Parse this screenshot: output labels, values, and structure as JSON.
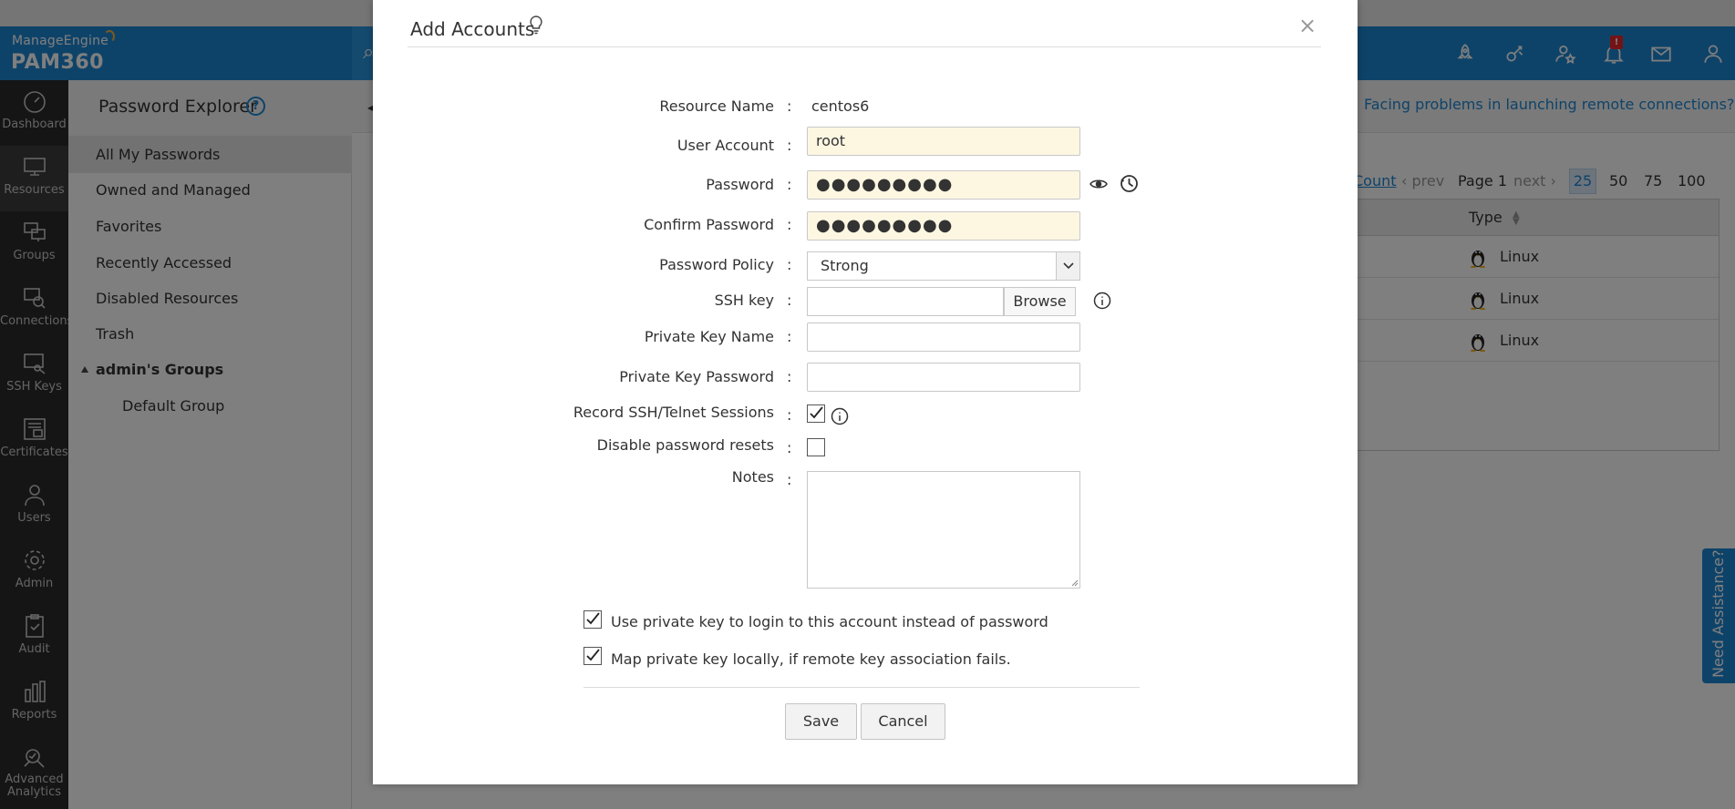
{
  "brand": {
    "small": "ManageEngine",
    "big": "PAM360"
  },
  "header": {
    "notification_count": "!"
  },
  "leftnav": [
    {
      "label": "Dashboard",
      "icon": "dashboard-icon"
    },
    {
      "label": "Resources",
      "icon": "monitor-icon"
    },
    {
      "label": "Groups",
      "icon": "groups-icon"
    },
    {
      "label": "Connections",
      "icon": "connections-icon"
    },
    {
      "label": "SSH Keys",
      "icon": "ssh-keys-icon"
    },
    {
      "label": "Certificates",
      "icon": "certificate-icon"
    },
    {
      "label": "Users",
      "icon": "user-icon"
    },
    {
      "label": "Admin",
      "icon": "gear-icon"
    },
    {
      "label": "Audit",
      "icon": "clipboard-icon"
    },
    {
      "label": "Reports",
      "icon": "bar-chart-icon"
    },
    {
      "label": "Advanced Analytics",
      "icon": "analytics-icon"
    }
  ],
  "panel": {
    "title": "Password Explorer",
    "help": "?",
    "items": [
      "All My Passwords",
      "Owned and Managed",
      "Favorites",
      "Recently Accessed",
      "Disabled Resources",
      "Trash"
    ],
    "group_header": "admin's Groups",
    "group_items": [
      "Default Group"
    ]
  },
  "content": {
    "facing_link": "Facing problems in launching remote connections?",
    "pager": {
      "count_label": "Count",
      "prev": "prev",
      "page": "Page 1",
      "next": "next",
      "sizes": [
        "25",
        "50",
        "75",
        "100"
      ],
      "selected_size": "25"
    },
    "table": {
      "type_header": "Type",
      "rows": [
        {
          "type": "Linux"
        },
        {
          "type": "Linux"
        },
        {
          "type": "Linux"
        }
      ]
    }
  },
  "assist_tab": "Need Assistance?",
  "modal": {
    "title": "Add Accounts",
    "close": "×",
    "colon": ":",
    "fields": {
      "resource_name": {
        "label": "Resource Name",
        "value": "centos6"
      },
      "user_account": {
        "label": "User Account",
        "value": "root"
      },
      "password": {
        "label": "Password",
        "value": "●●●●●●●●●"
      },
      "confirm_password": {
        "label": "Confirm Password",
        "value": "●●●●●●●●●"
      },
      "password_policy": {
        "label": "Password Policy",
        "value": "Strong"
      },
      "ssh_key": {
        "label": "SSH key",
        "browse": "Browse"
      },
      "private_key_name": {
        "label": "Private Key Name",
        "value": ""
      },
      "private_key_password": {
        "label": "Private Key Password",
        "value": ""
      },
      "record_sessions": {
        "label": "Record SSH/Telnet Sessions",
        "checked": true
      },
      "disable_resets": {
        "label": "Disable password resets",
        "checked": false
      },
      "notes": {
        "label": "Notes",
        "value": ""
      }
    },
    "options": [
      {
        "label": "Use private key to login to this account instead of password",
        "checked": true
      },
      {
        "label": "Map private key locally, if remote key association fails.",
        "checked": true
      }
    ],
    "buttons": {
      "save": "Save",
      "cancel": "Cancel"
    }
  },
  "colors": {
    "accent": "#1d86d3",
    "nav_bg": "#2a2a2a",
    "filled_input": "#fdf7e2"
  }
}
